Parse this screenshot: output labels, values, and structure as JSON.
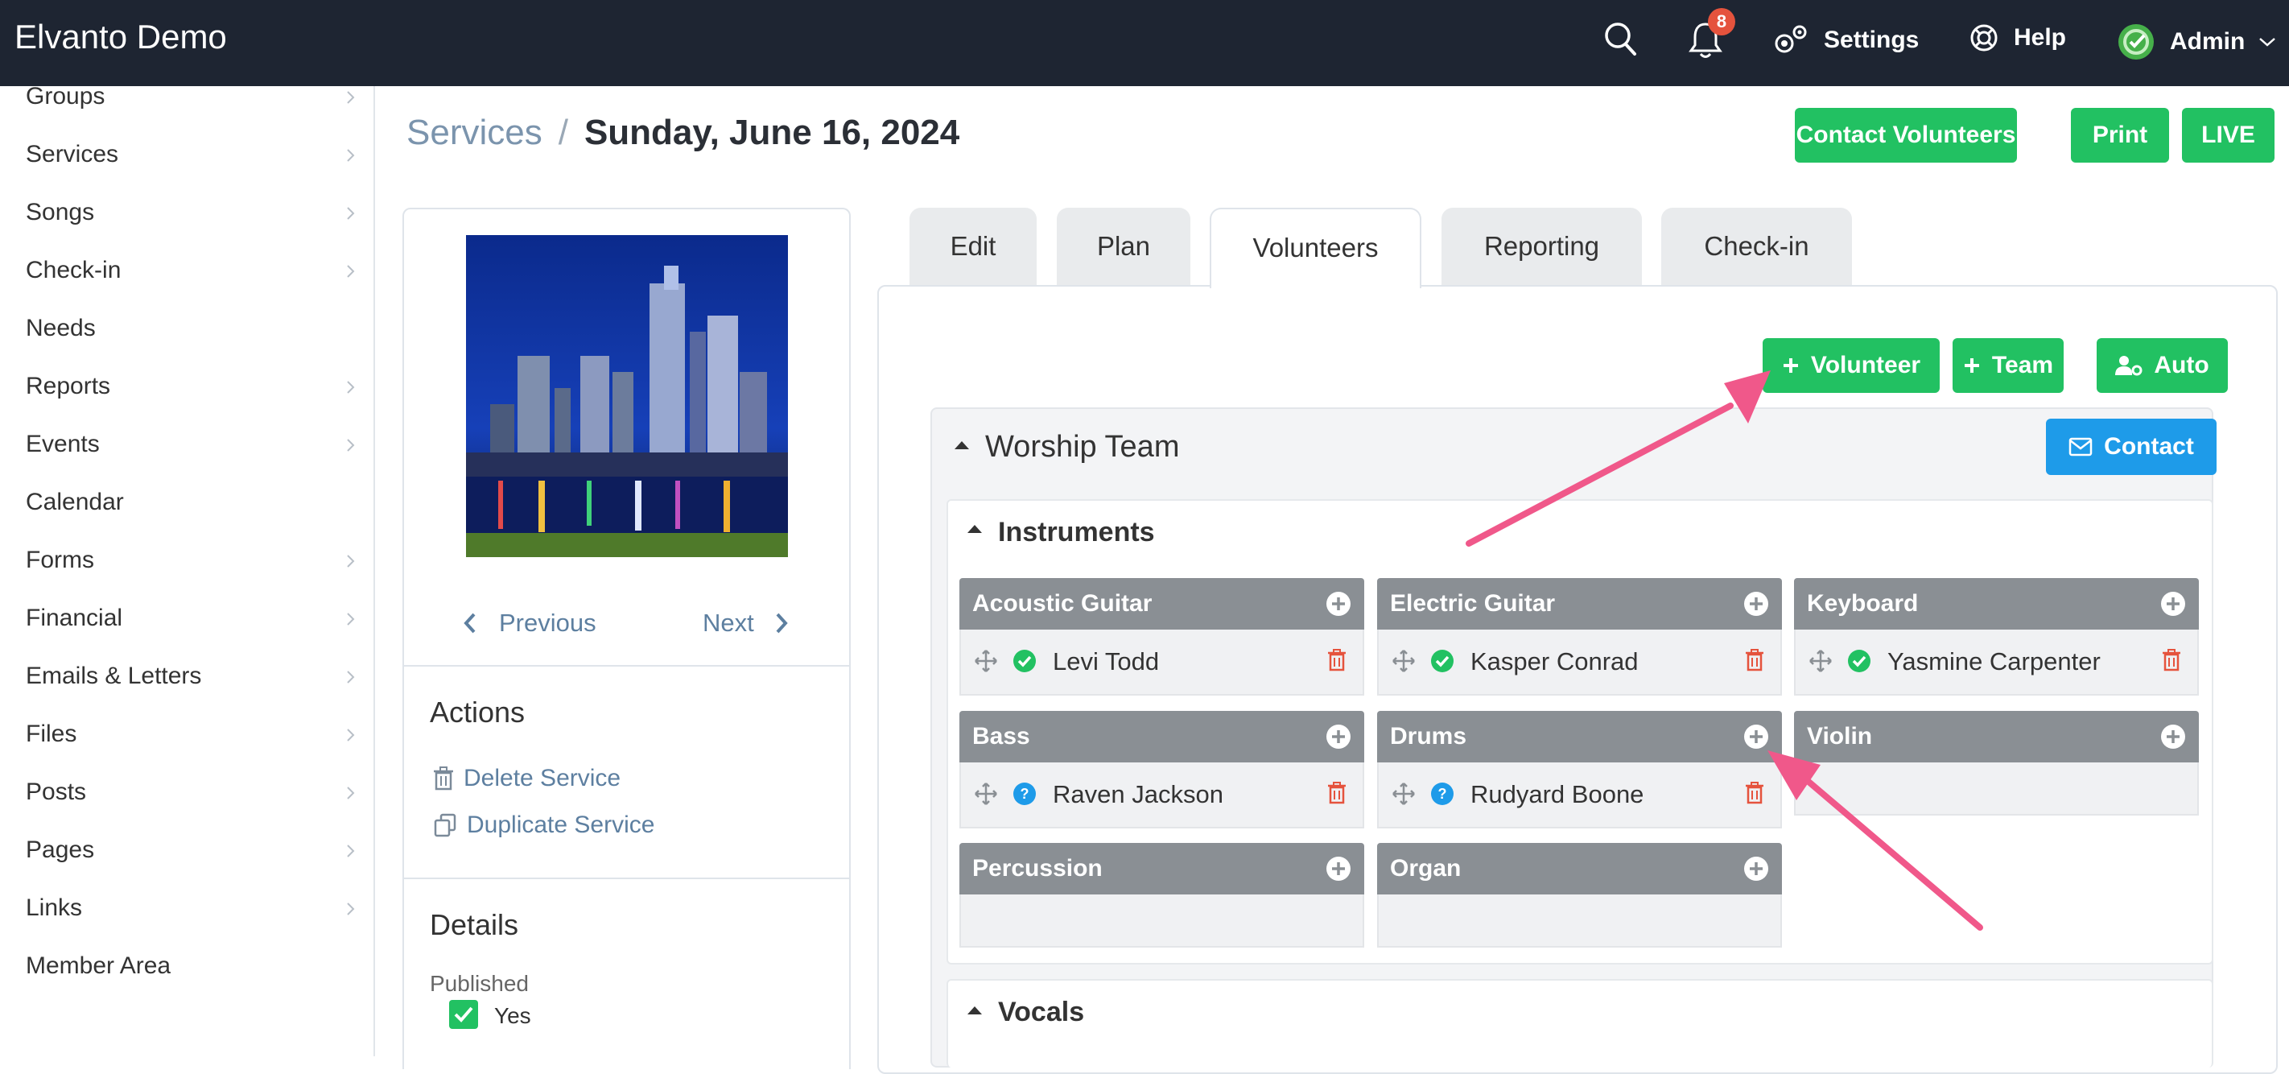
{
  "app": {
    "title": "Elvanto Demo"
  },
  "topbar": {
    "notification_count": "8",
    "settings_label": "Settings",
    "help_label": "Help",
    "user_label": "Admin"
  },
  "sidebar": {
    "items": [
      {
        "label": "Groups",
        "chevron": true
      },
      {
        "label": "Services",
        "chevron": true
      },
      {
        "label": "Songs",
        "chevron": true
      },
      {
        "label": "Check-in",
        "chevron": true
      },
      {
        "label": "Needs",
        "chevron": false
      },
      {
        "label": "Reports",
        "chevron": true
      },
      {
        "label": "Events",
        "chevron": true
      },
      {
        "label": "Calendar",
        "chevron": false
      },
      {
        "label": "Forms",
        "chevron": true
      },
      {
        "label": "Financial",
        "chevron": true
      },
      {
        "label": "Emails & Letters",
        "chevron": true
      },
      {
        "label": "Files",
        "chevron": true
      },
      {
        "label": "Posts",
        "chevron": true
      },
      {
        "label": "Pages",
        "chevron": true
      },
      {
        "label": "Links",
        "chevron": true
      },
      {
        "label": "Member Area",
        "chevron": false
      }
    ]
  },
  "breadcrumb": {
    "parent": "Services",
    "separator": "/",
    "current": "Sunday, June 16, 2024"
  },
  "header_buttons": {
    "contact": "Contact Volunteers",
    "print": "Print",
    "live": "LIVE"
  },
  "left_panel": {
    "previous": "Previous",
    "next": "Next",
    "actions_title": "Actions",
    "delete": "Delete Service",
    "duplicate": "Duplicate Service",
    "details_title": "Details",
    "published_label": "Published",
    "published_value": "Yes"
  },
  "tabs": [
    {
      "label": "Edit"
    },
    {
      "label": "Plan"
    },
    {
      "label": "Volunteers",
      "active": true
    },
    {
      "label": "Reporting"
    },
    {
      "label": "Check-in"
    }
  ],
  "volunteers": {
    "add_volunteer": "Volunteer",
    "add_team": "Team",
    "auto": "Auto",
    "team_name": "Worship Team",
    "contact": "Contact",
    "instruments_title": "Instruments",
    "vocals_title": "Vocals",
    "roles": [
      {
        "name": "Acoustic Guitar",
        "person": "Levi Todd",
        "status": "confirmed"
      },
      {
        "name": "Electric Guitar",
        "person": "Kasper Conrad",
        "status": "confirmed"
      },
      {
        "name": "Keyboard",
        "person": "Yasmine Carpenter",
        "status": "confirmed"
      },
      {
        "name": "Bass",
        "person": "Raven Jackson",
        "status": "pending"
      },
      {
        "name": "Drums",
        "person": "Rudyard Boone",
        "status": "pending"
      },
      {
        "name": "Violin",
        "person": "",
        "status": ""
      },
      {
        "name": "Percussion",
        "person": "",
        "status": ""
      },
      {
        "name": "Organ",
        "person": "",
        "status": ""
      }
    ]
  },
  "colors": {
    "topbar": "#1e2532",
    "accent_green": "#22c162",
    "accent_blue": "#1e9be9",
    "annotation_arrow": "#f0588a",
    "confirmed": "#22c162",
    "pending": "#1e9be9",
    "trash": "#e5533d"
  }
}
